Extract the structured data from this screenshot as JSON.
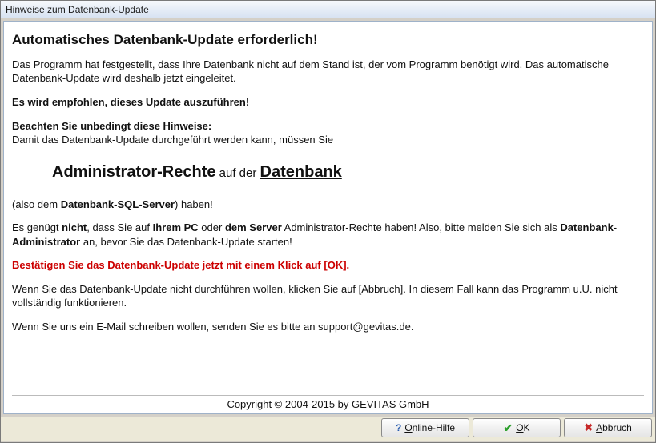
{
  "window": {
    "title": "Hinweise zum Datenbank-Update"
  },
  "content": {
    "heading": "Automatisches Datenbank-Update erforderlich!",
    "p1": "Das Programm hat festgestellt, dass Ihre Datenbank nicht auf dem Stand ist, der vom Programm benötigt wird. Das automatische Datenbank-Update wird deshalb jetzt eingeleitet.",
    "p2_bold": "Es wird empfohlen, dieses Update auszuführen!",
    "p3_bold": "Beachten Sie unbedingt diese Hinweise:",
    "p3_rest": "Damit das Datenbank-Update durchgeführt werden kann, müssen Sie",
    "admin_big1": "Administrator-Rechte",
    "admin_mid": " auf der ",
    "admin_big2": "Datenbank",
    "p4_a": "(also dem ",
    "p4_b": "Datenbank-SQL-Server",
    "p4_c": ") haben!",
    "p5_a": "Es genügt ",
    "p5_b": "nicht",
    "p5_c": ", dass Sie auf ",
    "p5_d": "Ihrem PC",
    "p5_e": " oder ",
    "p5_f": "dem Server",
    "p5_g": " Administrator-Rechte haben! Also, bitte melden Sie sich als ",
    "p5_h": "Datenbank-Administrator",
    "p5_i": " an, bevor Sie das Datenbank-Update starten!",
    "p6_red": "Bestätigen Sie das Datenbank-Update jetzt mit einem Klick auf [OK].",
    "p7": "Wenn Sie das Datenbank-Update nicht durchführen wollen, klicken Sie auf [Abbruch]. In diesem Fall kann das Programm u.U. nicht vollständig funktionieren.",
    "p8": "Wenn Sie uns ein E-Mail schreiben wollen, senden Sie es bitte an support@gevitas.de.",
    "copyright": "Copyright © 2004-2015 by GEVITAS GmbH"
  },
  "buttons": {
    "help_prefix": "O",
    "help_rest": "nline-Hilfe",
    "ok_prefix": "O",
    "ok_rest": "K",
    "cancel_prefix": "A",
    "cancel_rest": "bbruch"
  }
}
